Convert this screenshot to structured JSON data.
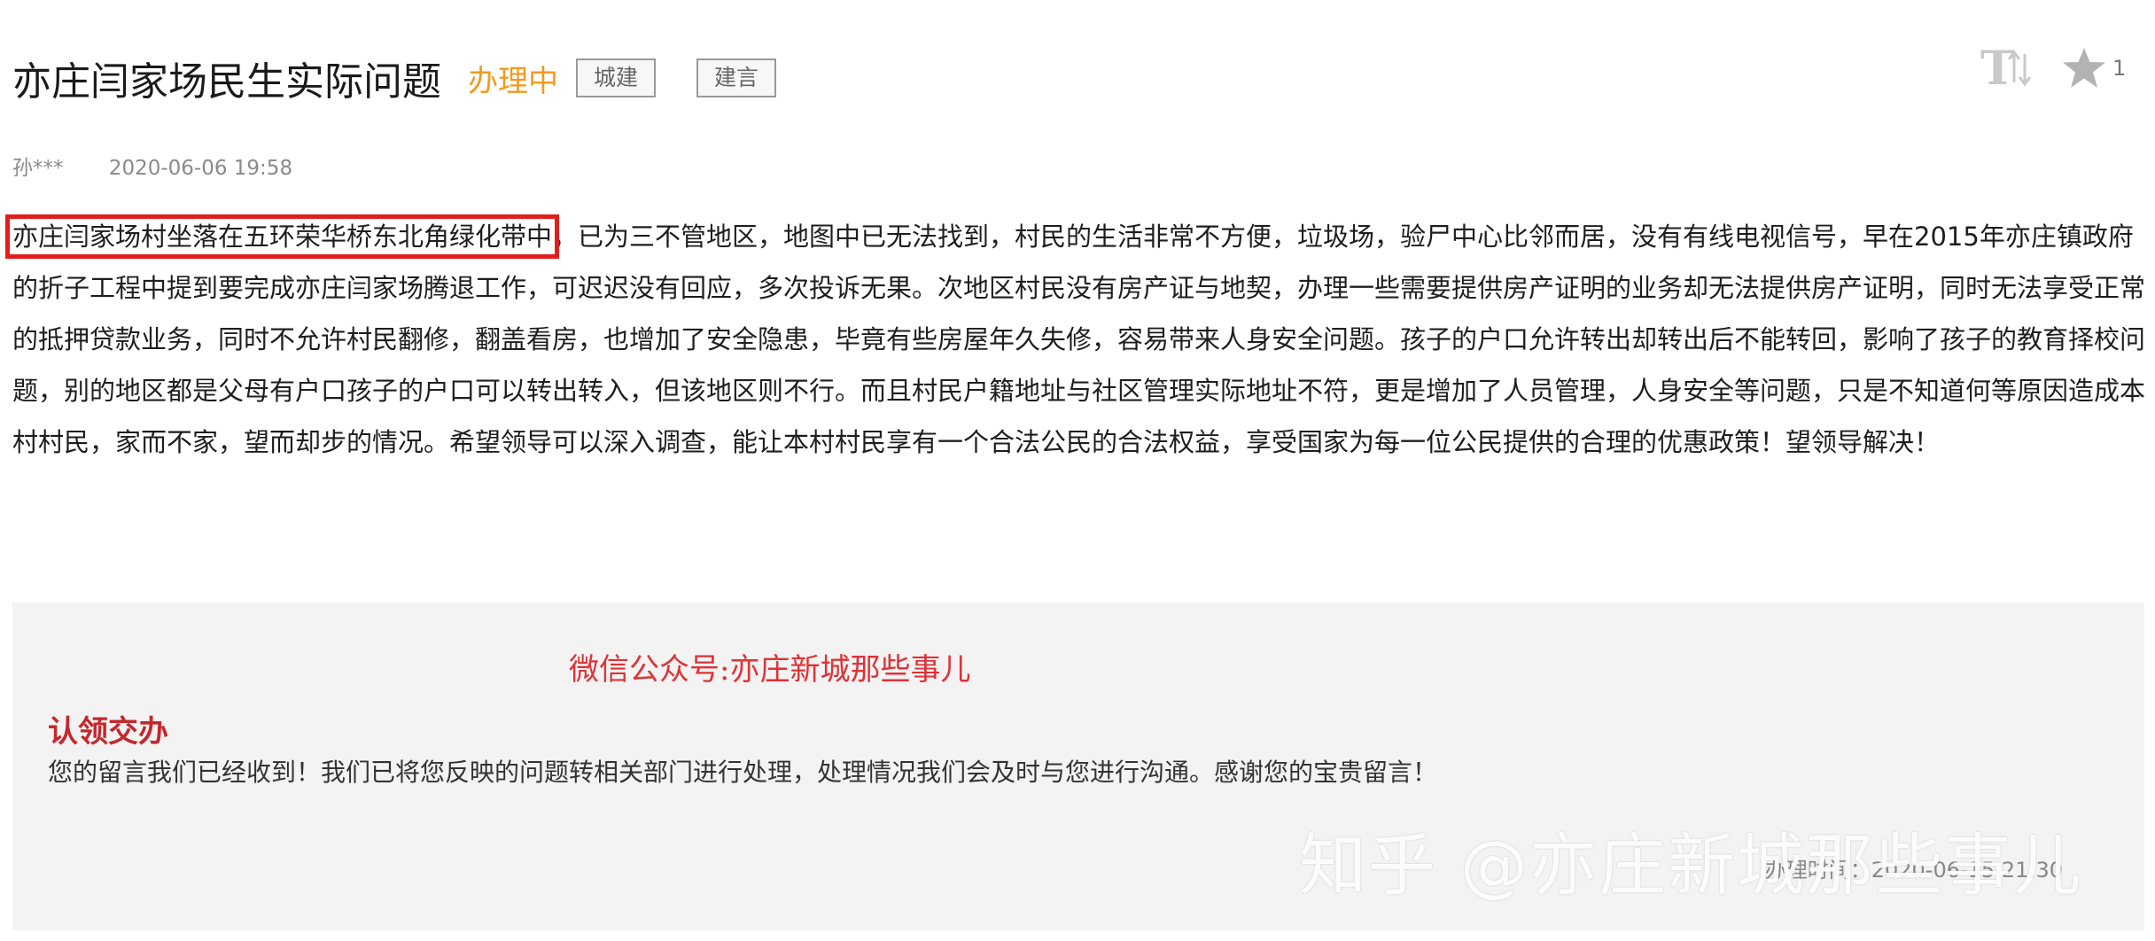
{
  "header": {
    "title": "亦庄闫家场民生实际问题",
    "status": "办理中",
    "tags": [
      "城建",
      "建言"
    ]
  },
  "toolbar": {
    "font_size_icon": "text-size-icon",
    "star_icon": "star-icon",
    "star_count": "1"
  },
  "meta": {
    "author": "孙***",
    "date": "2020-06-06 19:58"
  },
  "content": {
    "highlighted": "亦庄闫家场村坐落在五环荣华桥东北角绿化带中",
    "rest": "，已为三不管地区，地图中已无法找到，村民的生活非常不方便，垃圾场，验尸中心比邻而居，没有有线电视信号，早在2015年亦庄镇政府的折子工程中提到要完成亦庄闫家场腾退工作，可迟迟没有回应，多次投诉无果。次地区村民没有房产证与地契，办理一些需要提供房产证明的业务却无法提供房产证明，同时无法享受正常的抵押贷款业务，同时不允许村民翻修，翻盖看房，也增加了安全隐患，毕竟有些房屋年久失修，容易带来人身安全问题。孩子的户口允许转出却转出后不能转回，影响了孩子的教育择校问题，别的地区都是父母有户口孩子的户口可以转出转入，但该地区则不行。而且村民户籍地址与社区管理实际地址不符，更是增加了人员管理，人身安全等问题，只是不知道何等原因造成本村村民，家而不家，望而却步的情况。希望领导可以深入调查，能让本村村民享有一个合法公民的合法权益，享受国家为每一位公民提供的合理的优惠政策！望领导解决！"
  },
  "reply": {
    "wechat_note": "微信公众号:亦庄新城那些事儿",
    "title": "认领交办",
    "text": "您的留言我们已经收到！我们已将您反映的问题转相关部门进行处理，处理情况我们会及时与您进行沟通。感谢您的宝贵留言！",
    "time": "办理时间：2020-06-15 21:30"
  },
  "watermark": "知乎 @亦庄新城那些事儿",
  "colors": {
    "status": "#f29a1e",
    "highlight_box": "#e31d1d",
    "reply_title": "#c4282c",
    "wechat_note": "#e03236",
    "reply_background": "#f3f3f3"
  }
}
